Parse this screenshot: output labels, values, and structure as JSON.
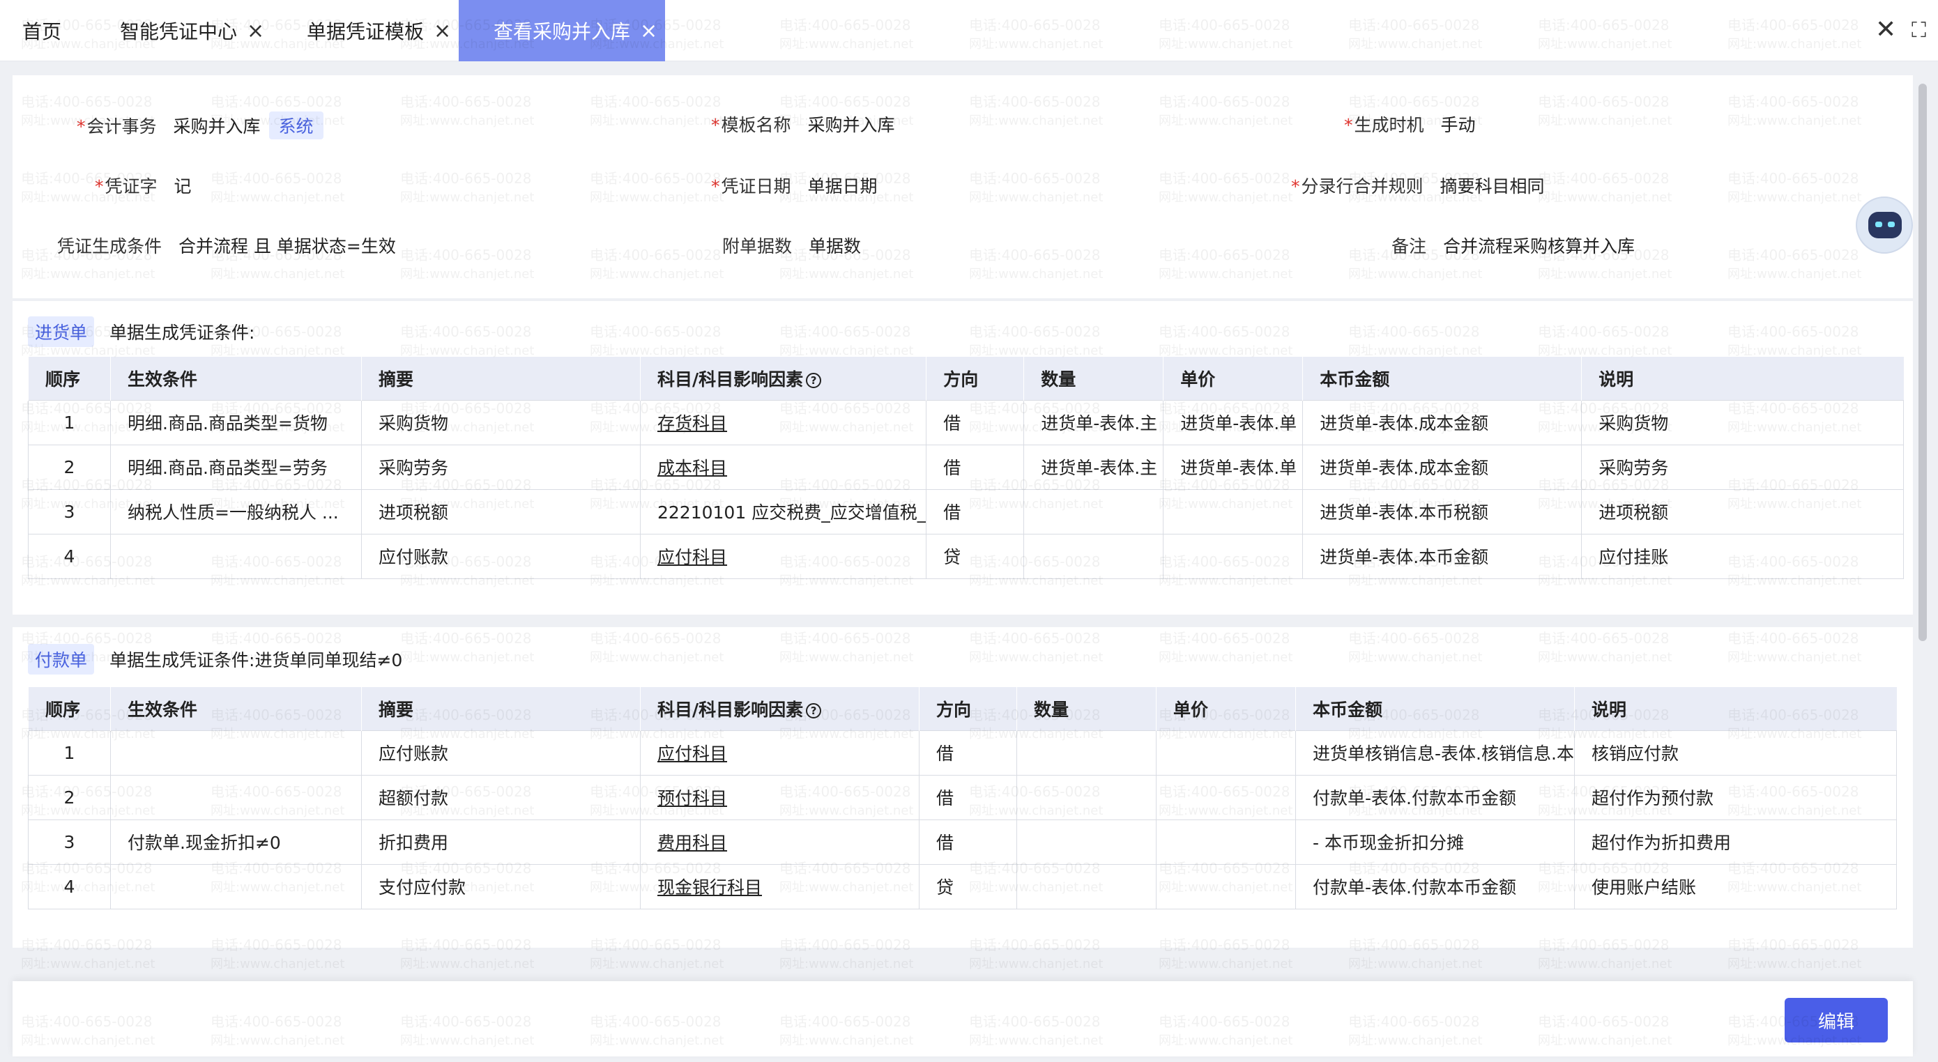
{
  "tabs": [
    {
      "label": "首页",
      "closable": false,
      "active": false
    },
    {
      "label": "智能凭证中心",
      "closable": true,
      "active": false
    },
    {
      "label": "单据凭证模板",
      "closable": true,
      "active": false
    },
    {
      "label": "查看采购并入库",
      "closable": true,
      "active": true
    }
  ],
  "tab_close_glyph": "×",
  "window": {
    "close_glyph": "✕",
    "fullscreen_glyph": "⛶"
  },
  "header_fields": {
    "accounting_affair": {
      "label": "会计事务",
      "value": "采购并入库",
      "tag": "系统",
      "required": true
    },
    "template_name": {
      "label": "模板名称",
      "value": "采购并入库",
      "required": true
    },
    "generate_timing": {
      "label": "生成时机",
      "value": "手动",
      "required": true
    },
    "voucher_word": {
      "label": "凭证字",
      "value": "记",
      "required": true
    },
    "voucher_date": {
      "label": "凭证日期",
      "value": "单据日期",
      "required": true
    },
    "merge_rule": {
      "label": "分录行合并规则",
      "value": "摘要科目相同",
      "required": true
    },
    "gen_condition": {
      "label": "凭证生成条件",
      "value": "合并流程 且 单据状态=生效",
      "required": false
    },
    "attach_count": {
      "label": "附单据数",
      "value": "单据数",
      "required": false
    },
    "remark": {
      "label": "备注",
      "value": "合并流程采购核算并入库",
      "required": false
    }
  },
  "required_mark": "*",
  "columns": [
    "顺序",
    "生效条件",
    "摘要",
    "科目/科目影响因素",
    "方向",
    "数量",
    "单价",
    "本币金额",
    "说明"
  ],
  "help_icon_glyph": "?",
  "sections": [
    {
      "tag": "进货单",
      "condition": "单据生成凭证条件:",
      "rows": [
        {
          "seq": "1",
          "cond": "明细.商品.商品类型=货物",
          "summary": "采购货物",
          "subject": "存货科目",
          "dir": "借",
          "qty": "进货单-表体.主",
          "price": "进货单-表体.单",
          "amount": "进货单-表体.成本金额",
          "note": "采购货物"
        },
        {
          "seq": "2",
          "cond": "明细.商品.商品类型=劳务",
          "summary": "采购劳务",
          "subject": "成本科目",
          "dir": "借",
          "qty": "进货单-表体.主",
          "price": "进货单-表体.单",
          "amount": "进货单-表体.成本金额",
          "note": "采购劳务"
        },
        {
          "seq": "3",
          "cond": "纳税人性质=一般纳税人 ...",
          "summary": "进项税额",
          "subject": "22210101 应交税费_应交增值税_",
          "dir": "借",
          "qty": "",
          "price": "",
          "amount": "进货单-表体.本币税额",
          "note": "进项税额"
        },
        {
          "seq": "4",
          "cond": "",
          "summary": "应付账款",
          "subject": "应付科目",
          "dir": "贷",
          "qty": "",
          "price": "",
          "amount": "进货单-表体.本币金额",
          "note": "应付挂账"
        }
      ]
    },
    {
      "tag": "付款单",
      "condition": "单据生成凭证条件:进货单同单现结≠0",
      "rows": [
        {
          "seq": "1",
          "cond": "",
          "summary": "应付账款",
          "subject": "应付科目",
          "dir": "借",
          "qty": "",
          "price": "",
          "amount": "进货单核销信息-表体.核销信息.本",
          "note": "核销应付款"
        },
        {
          "seq": "2",
          "cond": "",
          "summary": "超额付款",
          "subject": "预付科目",
          "dir": "借",
          "qty": "",
          "price": "",
          "amount": "付款单-表体.付款本币金额",
          "note": "超付作为预付款"
        },
        {
          "seq": "3",
          "cond": "付款单.现金折扣≠0",
          "summary": "折扣费用",
          "subject": "费用科目",
          "dir": "借",
          "qty": "",
          "price": "",
          "amount": "- 本币现金折扣分摊",
          "note": "超付作为折扣费用"
        },
        {
          "seq": "4",
          "cond": "",
          "summary": "支付应付款",
          "subject": "现金银行科目",
          "dir": "贷",
          "qty": "",
          "price": "",
          "amount": "付款单-表体.付款本币金额",
          "note": "使用账户结账"
        }
      ]
    }
  ],
  "footer": {
    "edit_label": "编辑"
  },
  "watermark": {
    "line1": "电话:400-665-0028",
    "line2": "网址:www.chanjet.net"
  }
}
